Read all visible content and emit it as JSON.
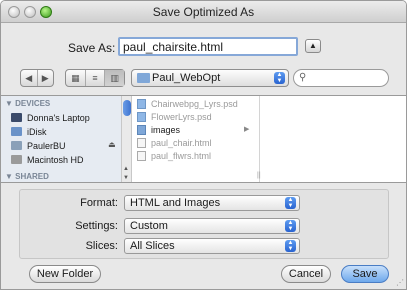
{
  "window": {
    "title": "Save Optimized As"
  },
  "save_as": {
    "label": "Save As:",
    "filename": "paul_chairsite.html"
  },
  "toolbar": {
    "back_glyph": "◀",
    "forward_glyph": "▶",
    "view_icon_glyph": "▦",
    "view_list_glyph": "≡",
    "view_column_glyph": "▥",
    "location": "Paul_WebOpt",
    "search_glyph": "⚲"
  },
  "sidebar": {
    "devices_heading": "▼ DEVICES",
    "shared_heading": "▼ SHARED",
    "items": [
      {
        "label": "Donna's Laptop",
        "icon": "laptop-icon"
      },
      {
        "label": "iDisk",
        "icon": "idisk-icon"
      },
      {
        "label": "PaulerBU",
        "icon": "drive-icon"
      },
      {
        "label": "Macintosh HD",
        "icon": "harddisk-icon"
      }
    ]
  },
  "files": [
    {
      "name": "Chairwebpg_Lyrs.psd",
      "enabled": false
    },
    {
      "name": "FlowerLyrs.psd",
      "enabled": false
    },
    {
      "name": "images",
      "enabled": true
    },
    {
      "name": "paul_chair.html",
      "enabled": false
    },
    {
      "name": "paul_flwrs.html",
      "enabled": false
    }
  ],
  "options": {
    "format_label": "Format:",
    "format_value": "HTML and Images",
    "settings_label": "Settings:",
    "settings_value": "Custom",
    "slices_label": "Slices:",
    "slices_value": "All Slices"
  },
  "buttons": {
    "new_folder": "New Folder",
    "cancel": "Cancel",
    "save": "Save"
  }
}
